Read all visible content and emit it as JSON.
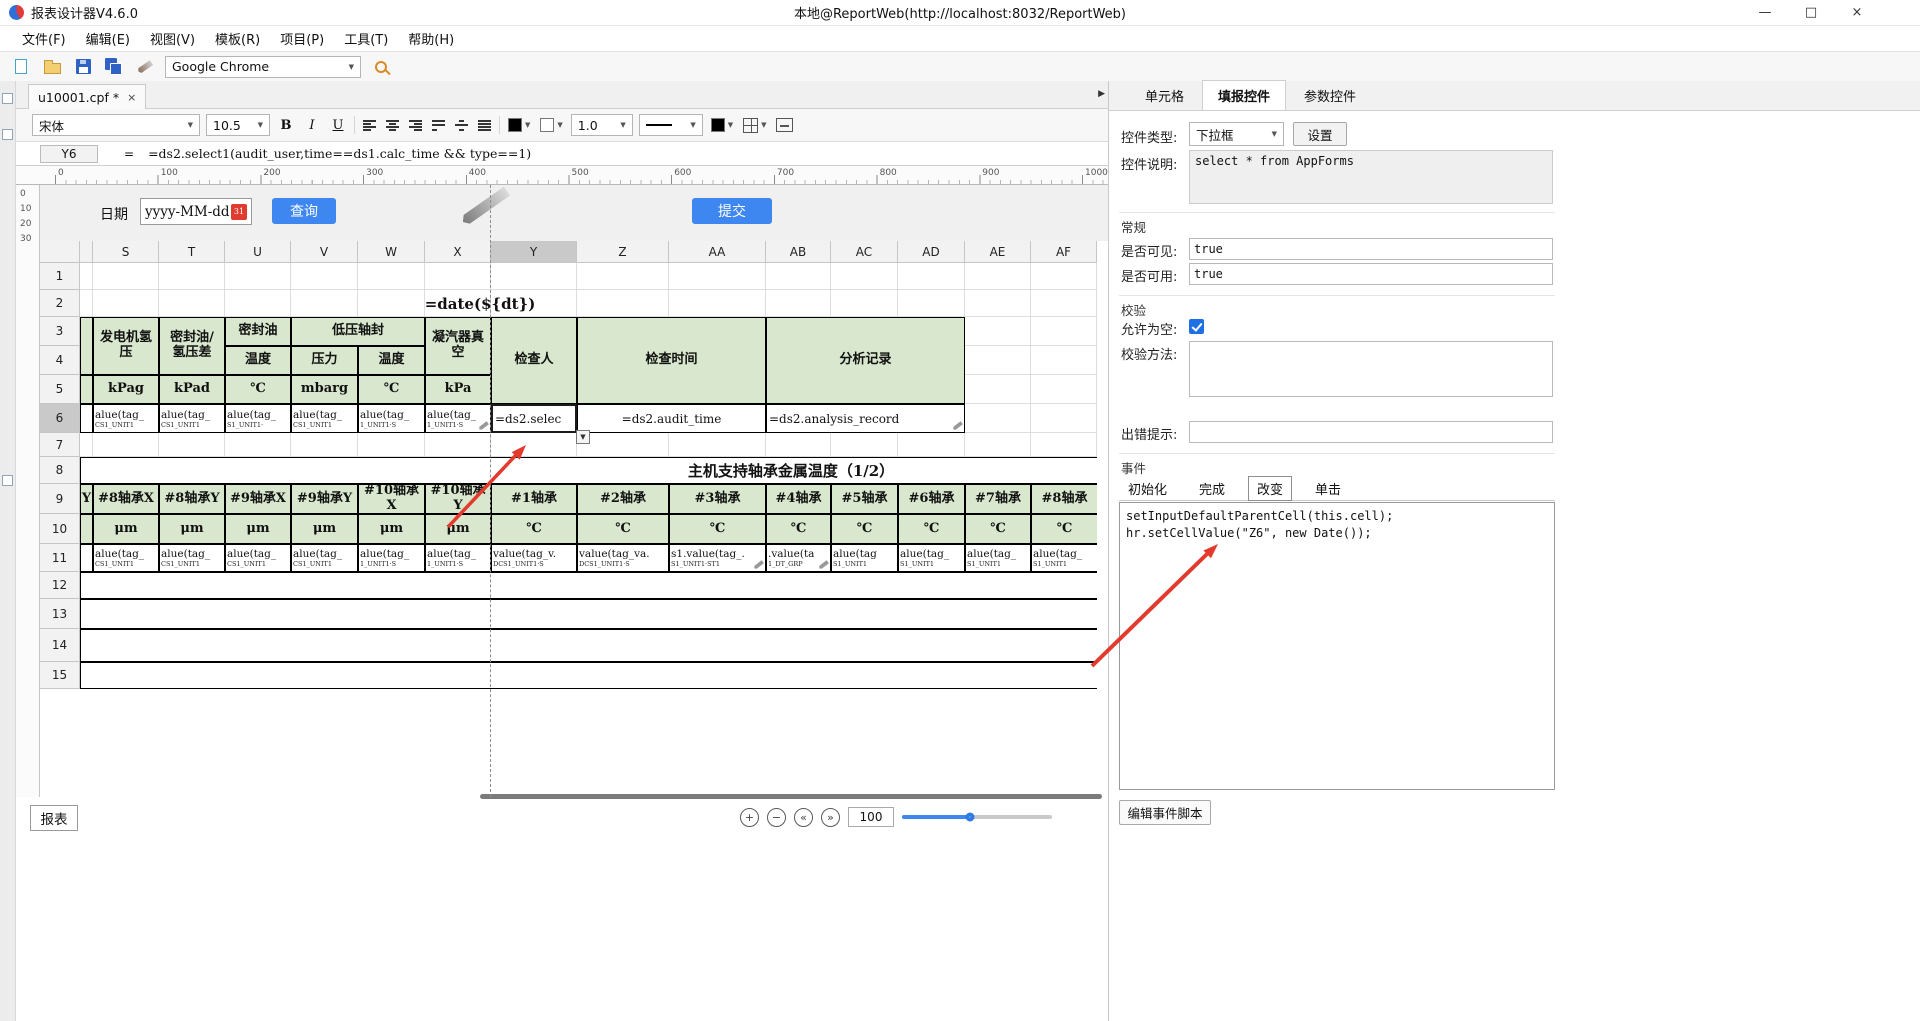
{
  "window": {
    "app_title": "报表设计器V4.6.0",
    "doc_title": "本地@ReportWeb(http://localhost:8032/ReportWeb)",
    "minimize": "—",
    "maximize": "□",
    "close": "×"
  },
  "menu": {
    "items": [
      "文件(F)",
      "编辑(E)",
      "视图(V)",
      "模板(R)",
      "项目(P)",
      "工具(T)",
      "帮助(H)"
    ]
  },
  "toolbar": {
    "browser": "Google Chrome"
  },
  "doc_tab": {
    "label": "u10001.cpf *",
    "close": "×",
    "scroll_right": "▶"
  },
  "format_bar": {
    "font": "宋体",
    "size": "10.5",
    "bold": "B",
    "italic": "I",
    "underline": "U",
    "line_width": "1.0"
  },
  "formula_bar": {
    "cell_ref": "Y6",
    "equals": "=",
    "formula": "=ds2.select1(audit_user,time==ds1.calc_time && type==1)"
  },
  "rulers": {
    "h_ticks": [
      "0",
      "100",
      "200",
      "300",
      "400",
      "500",
      "600",
      "700",
      "800",
      "900",
      "1000"
    ],
    "v_ticks": [
      "0",
      "10",
      "20",
      "30"
    ]
  },
  "report_form": {
    "date_label": "日期",
    "date_value": "yyyy-MM-dd",
    "calendar_icon": "31",
    "query_button": "查询",
    "submit_button": "提交"
  },
  "grid": {
    "col_headers": [
      "S",
      "T",
      "U",
      "V",
      "W",
      "X",
      "Y",
      "Z",
      "AA",
      "AB",
      "AC",
      "AD",
      "AE",
      "AF"
    ],
    "row_headers": [
      "1",
      "2",
      "3",
      "4",
      "5",
      "6",
      "7",
      "8",
      "9",
      "10",
      "11",
      "12",
      "13",
      "14",
      "15"
    ],
    "selected_column": "Y",
    "selected_row": "6",
    "combo_arrow": "▼",
    "cells": [
      {
        "r": 2,
        "c": "V",
        "cs": 5,
        "t": "=date(${dt})",
        "k": "title"
      },
      {
        "r": 3,
        "c": "SL",
        "rs": 2,
        "t": "",
        "k": "green"
      },
      {
        "r": 5,
        "c": "SL",
        "t": "",
        "k": "green"
      },
      {
        "r": 3,
        "c": "S",
        "rs": 2,
        "t": "发电机氢\n压",
        "k": "green"
      },
      {
        "r": 3,
        "c": "T",
        "rs": 2,
        "t": "密封油/\n氢压差",
        "k": "green"
      },
      {
        "r": 3,
        "c": "U",
        "t": "密封油",
        "k": "green"
      },
      {
        "r": 3,
        "c": "V",
        "cs": 2,
        "t": "低压轴封",
        "k": "green"
      },
      {
        "r": 3,
        "c": "X",
        "rs": 2,
        "t": "凝汽器真\n空",
        "k": "green"
      },
      {
        "r": 3,
        "c": "Y",
        "rs": 3,
        "t": "检查人",
        "k": "green"
      },
      {
        "r": 3,
        "c": "Z",
        "cs": 2,
        "rs": 3,
        "t": "检查时间",
        "k": "green"
      },
      {
        "r": 3,
        "c": "AB",
        "cs": 3,
        "rs": 3,
        "t": "分析记录",
        "k": "green"
      },
      {
        "r": 4,
        "c": "U",
        "t": "温度",
        "k": "green"
      },
      {
        "r": 4,
        "c": "V",
        "t": "压力",
        "k": "green"
      },
      {
        "r": 4,
        "c": "W",
        "t": "温度",
        "k": "green"
      },
      {
        "r": 5,
        "c": "S",
        "t": "kPag",
        "k": "green"
      },
      {
        "r": 5,
        "c": "T",
        "t": "kPad",
        "k": "green"
      },
      {
        "r": 5,
        "c": "U",
        "t": "℃",
        "k": "green"
      },
      {
        "r": 5,
        "c": "V",
        "t": "mbarg",
        "k": "green"
      },
      {
        "r": 5,
        "c": "W",
        "t": "℃",
        "k": "green"
      },
      {
        "r": 5,
        "c": "X",
        "t": "kPa",
        "k": "green"
      },
      {
        "r": 6,
        "c": "SL",
        "t": "",
        "k": "frag"
      },
      {
        "r": 6,
        "c": "S",
        "t": "alue(tag_",
        "t2": "CS1_UNIT1",
        "k": "frag"
      },
      {
        "r": 6,
        "c": "T",
        "t": "alue(tag_",
        "t2": "CS1_UNIT1",
        "k": "frag"
      },
      {
        "r": 6,
        "c": "U",
        "t": "alue(tag_",
        "t2": "S1_UNIT1·",
        "k": "frag"
      },
      {
        "r": 6,
        "c": "V",
        "t": "alue(tag_",
        "t2": "CS1_UNIT1",
        "k": "frag"
      },
      {
        "r": 6,
        "c": "W",
        "t": "alue(tag_",
        "t2": "1_UNIT1·S",
        "k": "frag"
      },
      {
        "r": 6,
        "c": "X",
        "t": "alue(tag_",
        "t2": "1_UNIT1·S",
        "k": "frag",
        "pencil": true
      },
      {
        "r": 6,
        "c": "Y",
        "t": "=ds2.selec",
        "k": "sel"
      },
      {
        "r": 6,
        "c": "Z",
        "cs": 2,
        "t": "=ds2.audit_time",
        "k": "fx"
      },
      {
        "r": 6,
        "c": "AB",
        "cs": 3,
        "t": "=ds2.analysis_record",
        "k": "fx",
        "left": true,
        "pencil": true
      },
      {
        "r": 8,
        "c": "SL",
        "cs": 15,
        "t": "主机支持轴承金属温度（1/2）",
        "k": "band",
        "noR": true
      },
      {
        "r": 9,
        "c": "SL",
        "t": "Y",
        "k": "green"
      },
      {
        "r": 9,
        "c": "S",
        "t": "#8轴承X",
        "k": "green"
      },
      {
        "r": 9,
        "c": "T",
        "t": "#8轴承Y",
        "k": "green"
      },
      {
        "r": 9,
        "c": "U",
        "t": "#9轴承X",
        "k": "green"
      },
      {
        "r": 9,
        "c": "V",
        "t": "#9轴承Y",
        "k": "green"
      },
      {
        "r": 9,
        "c": "W",
        "t": "#10轴承\nX",
        "k": "green"
      },
      {
        "r": 9,
        "c": "X",
        "t": "#10轴承\nY",
        "k": "green"
      },
      {
        "r": 9,
        "c": "Y",
        "t": "#1轴承",
        "k": "green"
      },
      {
        "r": 9,
        "c": "Z",
        "t": "#2轴承",
        "k": "green"
      },
      {
        "r": 9,
        "c": "AA",
        "t": "#3轴承",
        "k": "green"
      },
      {
        "r": 9,
        "c": "AB",
        "t": "#4轴承",
        "k": "green"
      },
      {
        "r": 9,
        "c": "AC",
        "t": "#5轴承",
        "k": "green"
      },
      {
        "r": 9,
        "c": "AD",
        "t": "#6轴承",
        "k": "green"
      },
      {
        "r": 9,
        "c": "AE",
        "t": "#7轴承",
        "k": "green"
      },
      {
        "r": 9,
        "c": "AF",
        "t": "#8轴承",
        "k": "green",
        "noR": true
      },
      {
        "r": 10,
        "c": "SL",
        "t": "",
        "k": "green"
      },
      {
        "r": 10,
        "c": "S",
        "t": "μm",
        "k": "green"
      },
      {
        "r": 10,
        "c": "T",
        "t": "μm",
        "k": "green"
      },
      {
        "r": 10,
        "c": "U",
        "t": "μm",
        "k": "green"
      },
      {
        "r": 10,
        "c": "V",
        "t": "μm",
        "k": "green"
      },
      {
        "r": 10,
        "c": "W",
        "t": "μm",
        "k": "green"
      },
      {
        "r": 10,
        "c": "X",
        "t": "μm",
        "k": "green"
      },
      {
        "r": 10,
        "c": "Y",
        "t": "℃",
        "k": "green"
      },
      {
        "r": 10,
        "c": "Z",
        "t": "℃",
        "k": "green"
      },
      {
        "r": 10,
        "c": "AA",
        "t": "℃",
        "k": "green"
      },
      {
        "r": 10,
        "c": "AB",
        "t": "℃",
        "k": "green"
      },
      {
        "r": 10,
        "c": "AC",
        "t": "℃",
        "k": "green"
      },
      {
        "r": 10,
        "c": "AD",
        "t": "℃",
        "k": "green"
      },
      {
        "r": 10,
        "c": "AE",
        "t": "℃",
        "k": "green"
      },
      {
        "r": 10,
        "c": "AF",
        "t": "℃",
        "k": "green",
        "noR": true
      },
      {
        "r": 11,
        "c": "SL",
        "t": "",
        "k": "frag"
      },
      {
        "r": 11,
        "c": "S",
        "t": "alue(tag_",
        "t2": "CS1_UNIT1",
        "k": "frag"
      },
      {
        "r": 11,
        "c": "T",
        "t": "alue(tag_",
        "t2": "CS1_UNIT1",
        "k": "frag"
      },
      {
        "r": 11,
        "c": "U",
        "t": "alue(tag_",
        "t2": "CS1_UNIT1",
        "k": "frag"
      },
      {
        "r": 11,
        "c": "V",
        "t": "alue(tag_",
        "t2": "CS1_UNIT1",
        "k": "frag"
      },
      {
        "r": 11,
        "c": "W",
        "t": "alue(tag_",
        "t2": "1_UNIT1·S",
        "k": "frag"
      },
      {
        "r": 11,
        "c": "X",
        "t": "alue(tag_",
        "t2": "1_UNIT1·S",
        "k": "frag"
      },
      {
        "r": 11,
        "c": "Y",
        "t": "value(tag_v.",
        "t2": "DCS1_UNIT1·S",
        "k": "frag"
      },
      {
        "r": 11,
        "c": "Z",
        "t": "value(tag_va.",
        "t2": "DCS1_UNIT1·S",
        "k": "frag"
      },
      {
        "r": 11,
        "c": "AA",
        "t": "s1.value(tag_.",
        "t2": "S1_UNIT1·ST1",
        "k": "frag",
        "pencil": true
      },
      {
        "r": 11,
        "c": "AB",
        "t": ".value(ta",
        "t2": "1_DT_GRP",
        "k": "frag",
        "pencil": true
      },
      {
        "r": 11,
        "c": "AC",
        "t": "alue(tag",
        "t2": "S1_UNIT1",
        "k": "frag"
      },
      {
        "r": 11,
        "c": "AD",
        "t": "alue(tag_",
        "t2": "S1_UNIT1",
        "k": "frag"
      },
      {
        "r": 11,
        "c": "AE",
        "t": "alue(tag_",
        "t2": "S1_UNIT1",
        "k": "frag"
      },
      {
        "r": 11,
        "c": "AF",
        "t": "alue(tag_",
        "t2": "S1_UNIT1",
        "k": "frag",
        "noR": true
      },
      {
        "r": 12,
        "c": "SL",
        "cs": 15,
        "t": "",
        "k": "open",
        "noR": true
      },
      {
        "r": 13,
        "c": "SL",
        "cs": 15,
        "t": "",
        "k": "open",
        "noR": true
      },
      {
        "r": 14,
        "c": "SL",
        "cs": 15,
        "t": "",
        "k": "open",
        "noR": true
      },
      {
        "r": 15,
        "c": "SL",
        "cs": 15,
        "t": "",
        "k": "open",
        "noR": true
      }
    ]
  },
  "right_panel": {
    "tabs": [
      "单元格",
      "填报控件",
      "参数控件"
    ],
    "active_tab": "填报控件",
    "control_type_label": "控件类型:",
    "control_type_value": "下拉框",
    "settings_button": "设置",
    "control_desc_label": "控件说明:",
    "control_desc_value": "select * from AppForms",
    "section_general": "常规",
    "visible_label": "是否可见:",
    "visible_value": "true",
    "enabled_label": "是否可用:",
    "enabled_value": "true",
    "section_validate": "校验",
    "allow_empty_label": "允许为空:",
    "validate_method_label": "校验方法:",
    "error_hint_label": "出错提示:",
    "section_event": "事件",
    "event_tabs": [
      "初始化",
      "完成",
      "改变",
      "单击"
    ],
    "active_event_tab": "改变",
    "event_code": "setInputDefaultParentCell(this.cell);\nhr.setCellValue(\"Z6\", new Date());",
    "edit_script_button": "编辑事件脚本"
  },
  "bottom_bar": {
    "sheet_tab": "报表",
    "zoom_in": "+",
    "zoom_out": "−",
    "nav_first": "«",
    "nav_last": "»",
    "zoom_value": "100"
  },
  "colors": {
    "accent_blue": "#3f87f0",
    "header_green": "#d8e7cd",
    "annotation_red": "#e23b2e"
  }
}
